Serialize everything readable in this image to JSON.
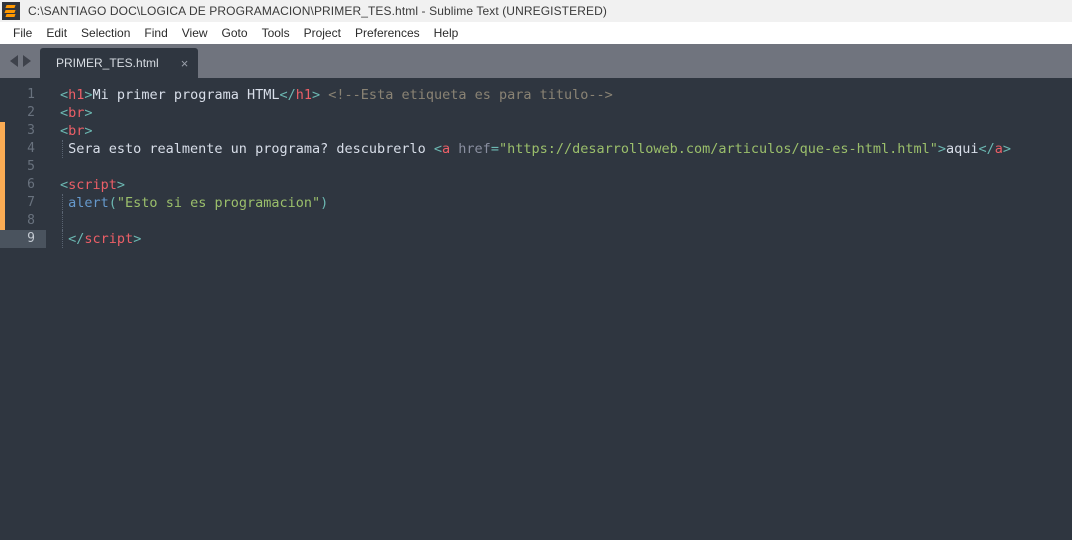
{
  "window": {
    "title": "C:\\SANTIAGO DOC\\LOGICA DE PROGRAMACION\\PRIMER_TES.html - Sublime Text (UNREGISTERED)",
    "app_icon": "sublime-text-logo-icon"
  },
  "menubar": {
    "items": [
      {
        "label": "File"
      },
      {
        "label": "Edit"
      },
      {
        "label": "Selection"
      },
      {
        "label": "Find"
      },
      {
        "label": "View"
      },
      {
        "label": "Goto"
      },
      {
        "label": "Tools"
      },
      {
        "label": "Project"
      },
      {
        "label": "Preferences"
      },
      {
        "label": "Help"
      }
    ]
  },
  "tabbar": {
    "prev_icon": "arrow-left-icon",
    "next_icon": "arrow-right-icon",
    "tabs": [
      {
        "label": "PRIMER_TES.html",
        "close_label": "×",
        "active": true
      }
    ]
  },
  "editor": {
    "active_line": 9,
    "modified_lines": {
      "from": 3,
      "to": 9
    },
    "colors": {
      "background": "#2f3640",
      "gutter_text": "#69727e",
      "active_line_gutter_bg": "#4a535e",
      "modified_strip": "#fbac54",
      "punctuation": "#6cb8b2",
      "tag_name": "#ec5f67",
      "plain_text": "#d8dee9",
      "comment": "#8a8374",
      "attribute": "#8a8fa0",
      "string": "#9bbf6b",
      "function": "#6699cc"
    },
    "lines": [
      {
        "number": "1",
        "indent": false,
        "tokens": [
          {
            "t": "<",
            "c": "punct"
          },
          {
            "t": "h1",
            "c": "tagname"
          },
          {
            "t": ">",
            "c": "punct"
          },
          {
            "t": "Mi primer programa HTML",
            "c": "text"
          },
          {
            "t": "</",
            "c": "punct"
          },
          {
            "t": "h1",
            "c": "tagname"
          },
          {
            "t": ">",
            "c": "punct"
          },
          {
            "t": " ",
            "c": "text"
          },
          {
            "t": "<!--Esta etiqueta es para titulo-->",
            "c": "comment"
          }
        ]
      },
      {
        "number": "2",
        "indent": false,
        "tokens": [
          {
            "t": "<",
            "c": "punct"
          },
          {
            "t": "br",
            "c": "tagname"
          },
          {
            "t": ">",
            "c": "punct"
          }
        ]
      },
      {
        "number": "3",
        "indent": false,
        "tokens": [
          {
            "t": "<",
            "c": "punct"
          },
          {
            "t": "br",
            "c": "tagname"
          },
          {
            "t": ">",
            "c": "punct"
          }
        ]
      },
      {
        "number": "4",
        "indent": true,
        "tokens": [
          {
            "t": " Sera esto realmente un programa? descubrerlo ",
            "c": "text"
          },
          {
            "t": "<",
            "c": "punct"
          },
          {
            "t": "a",
            "c": "tagname"
          },
          {
            "t": " ",
            "c": "text"
          },
          {
            "t": "href",
            "c": "attr"
          },
          {
            "t": "=",
            "c": "punct"
          },
          {
            "t": "\"https://desarrolloweb.com/articulos/que-es-html.html\"",
            "c": "string"
          },
          {
            "t": ">",
            "c": "punct"
          },
          {
            "t": "aqui",
            "c": "text"
          },
          {
            "t": "</",
            "c": "punct"
          },
          {
            "t": "a",
            "c": "tagname"
          },
          {
            "t": ">",
            "c": "punct"
          }
        ]
      },
      {
        "number": "5",
        "indent": false,
        "tokens": []
      },
      {
        "number": "6",
        "indent": false,
        "tokens": [
          {
            "t": "<",
            "c": "punct"
          },
          {
            "t": "script",
            "c": "tagname"
          },
          {
            "t": ">",
            "c": "punct"
          }
        ]
      },
      {
        "number": "7",
        "indent": true,
        "tokens": [
          {
            "t": " ",
            "c": "text"
          },
          {
            "t": "alert",
            "c": "func"
          },
          {
            "t": "(",
            "c": "punct"
          },
          {
            "t": "\"Esto si es programacion\"",
            "c": "string"
          },
          {
            "t": ")",
            "c": "punct"
          }
        ]
      },
      {
        "number": "8",
        "indent": true,
        "tokens": []
      },
      {
        "number": "9",
        "indent": true,
        "active": true,
        "tokens": [
          {
            "t": " ",
            "c": "text"
          },
          {
            "t": "</",
            "c": "punct"
          },
          {
            "t": "script",
            "c": "tagname"
          },
          {
            "t": ">",
            "c": "punct"
          }
        ]
      }
    ]
  }
}
